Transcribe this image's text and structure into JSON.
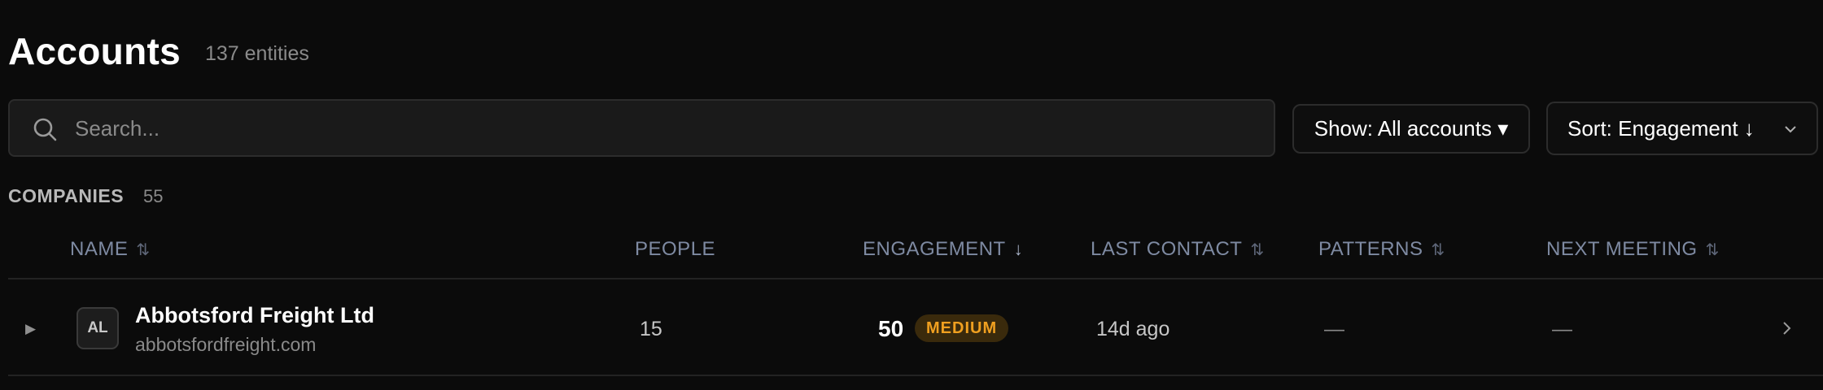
{
  "header": {
    "title": "Accounts",
    "entity_count": "137 entities"
  },
  "search": {
    "placeholder": "Search...",
    "value": ""
  },
  "filters": {
    "show_label": "Show: All accounts ▾",
    "sort_label": "Sort: Engagement ↓"
  },
  "section": {
    "label": "COMPANIES",
    "count": "55"
  },
  "table": {
    "columns": [
      {
        "label": "NAME",
        "sort_glyph": "⇅"
      },
      {
        "label": "PEOPLE",
        "sort_glyph": ""
      },
      {
        "label": "ENGAGEMENT",
        "sort_glyph": "↓"
      },
      {
        "label": "LAST CONTACT",
        "sort_glyph": "⇅"
      },
      {
        "label": "PATTERNS",
        "sort_glyph": "⇅"
      },
      {
        "label": "NEXT MEETING",
        "sort_glyph": "⇅"
      }
    ],
    "rows": [
      {
        "initials": "AL",
        "name": "Abbotsford Freight Ltd",
        "domain": "abbotsfordfreight.com",
        "people": "15",
        "engagement_score": "50",
        "engagement_level": "MEDIUM",
        "last_contact": "14d ago",
        "patterns": "—",
        "next_meeting": "—"
      }
    ]
  },
  "colors": {
    "background": "#0b0b0b",
    "header_text": "#7e8aa2",
    "badge_medium_bg": "#3a2a0c",
    "badge_medium_text": "#f0a020"
  }
}
